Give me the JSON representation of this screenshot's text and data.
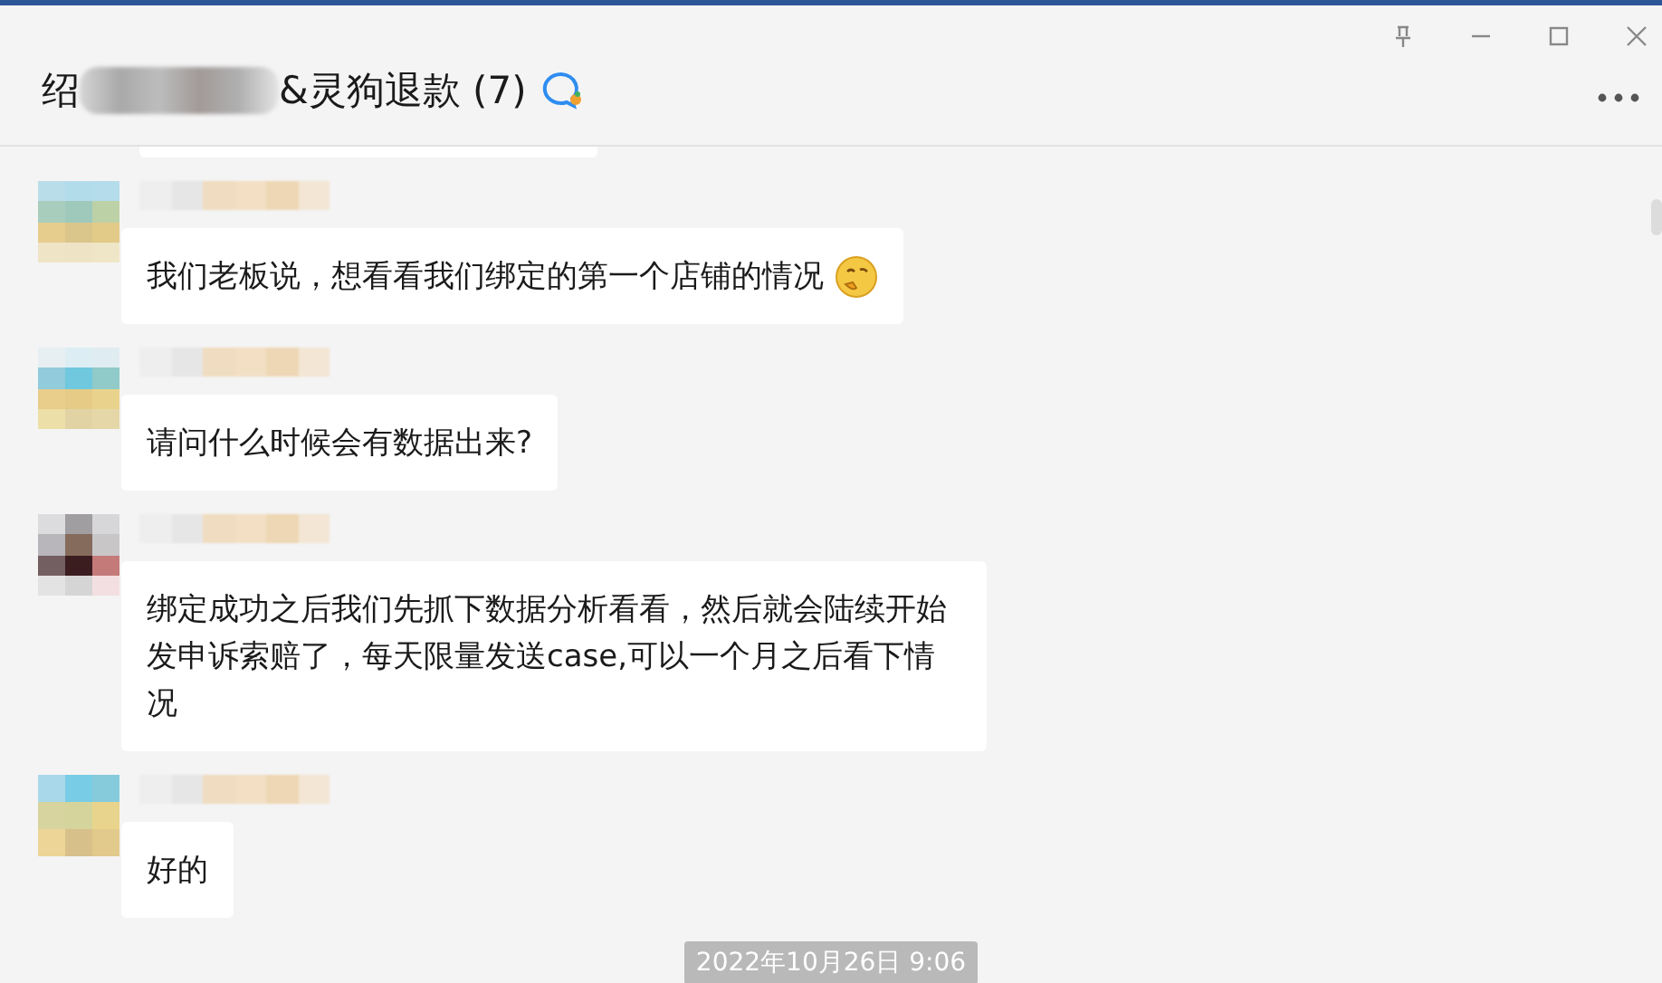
{
  "window": {
    "title_start": "绍",
    "title_end": "&灵狗退款 (7)"
  },
  "messages": [
    {
      "kind": "text_with_emoji",
      "text": "我们老板说，想看看我们绑定的第一个店铺的情况"
    },
    {
      "kind": "text",
      "text": "请问什么时候会有数据出来?"
    },
    {
      "kind": "text",
      "text": "绑定成功之后我们先抓下数据分析看看，然后就会陆续开始发申诉索赔了，每天限量发送case,可以一个月之后看下情况"
    },
    {
      "kind": "text",
      "text": "好的"
    }
  ],
  "timestamp": "2022年10月26日 9:06"
}
